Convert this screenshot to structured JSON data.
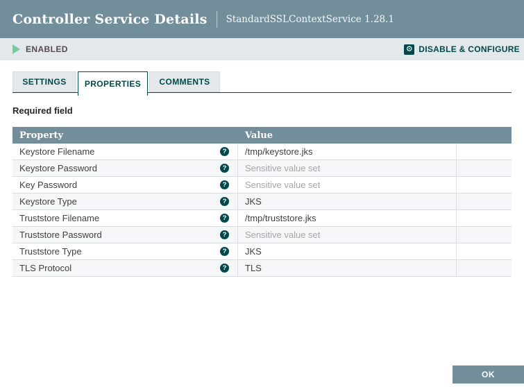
{
  "header": {
    "title": "Controller Service Details",
    "subtitle": "StandardSSLContextService 1.28.1"
  },
  "status_bar": {
    "state_label": "ENABLED",
    "action_label": "DISABLE & CONFIGURE"
  },
  "tabs": [
    {
      "label": "SETTINGS",
      "active": false
    },
    {
      "label": "PROPERTIES",
      "active": true
    },
    {
      "label": "COMMENTS",
      "active": false
    }
  ],
  "required_field_label": "Required field",
  "properties_table": {
    "columns": [
      "Property",
      "Value"
    ],
    "rows": [
      {
        "property": "Keystore Filename",
        "value": "/tmp/keystore.jks",
        "sensitive": false
      },
      {
        "property": "Keystore Password",
        "value": "Sensitive value set",
        "sensitive": true
      },
      {
        "property": "Key Password",
        "value": "Sensitive value set",
        "sensitive": true
      },
      {
        "property": "Keystore Type",
        "value": "JKS",
        "sensitive": false
      },
      {
        "property": "Truststore Filename",
        "value": "/tmp/truststore.jks",
        "sensitive": false
      },
      {
        "property": "Truststore Password",
        "value": "Sensitive value set",
        "sensitive": true
      },
      {
        "property": "Truststore Type",
        "value": "JKS",
        "sensitive": false
      },
      {
        "property": "TLS Protocol",
        "value": "TLS",
        "sensitive": false
      }
    ]
  },
  "icons": {
    "help_glyph": "?",
    "gear_glyph": "⚙"
  },
  "footer": {
    "ok_label": "OK"
  },
  "colors": {
    "header_bg": "#728E9B",
    "accent_teal": "#004849",
    "enabled_green": "#7DC7A0",
    "status_bar_bg": "#E3E8EB",
    "row_alt_bg": "#F4F6F7",
    "sensitive_text": "#A5A6A8"
  }
}
